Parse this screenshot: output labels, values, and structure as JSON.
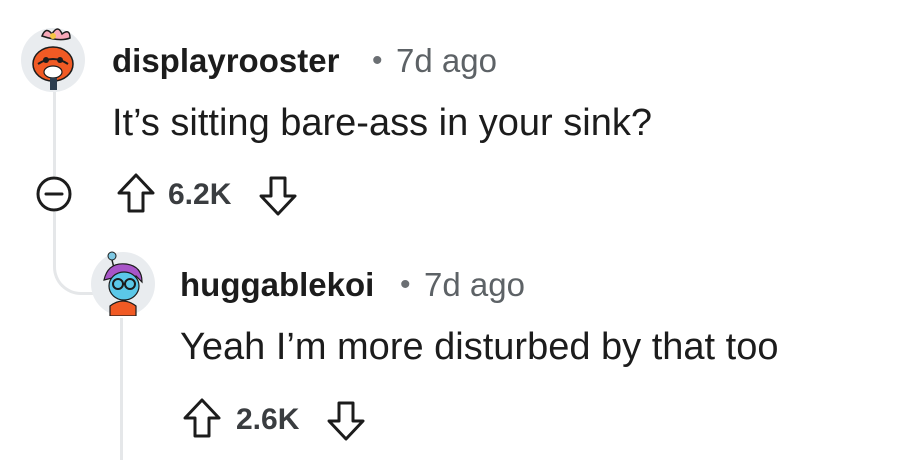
{
  "comments": [
    {
      "username": "displayrooster",
      "separator": "•",
      "timestamp": "7d ago",
      "body": "It’s sitting bare-ass in your sink?",
      "score": "6.2K",
      "avatar_icon": "rooster-avatar-icon"
    },
    {
      "username": "huggablekoi",
      "separator": "•",
      "timestamp": "7d ago",
      "body": "Yeah I’m more disturbed by that too",
      "score": "2.6K",
      "avatar_icon": "koi-avatar-icon"
    }
  ],
  "icons": {
    "collapse": "collapse-minus-icon",
    "upvote": "upvote-arrow-icon",
    "downvote": "downvote-arrow-icon"
  },
  "colors": {
    "text": "#1c1c1c",
    "meta": "#5d6266",
    "thread_line": "#e5e7e9",
    "icon_stroke": "#1c1c1c"
  }
}
